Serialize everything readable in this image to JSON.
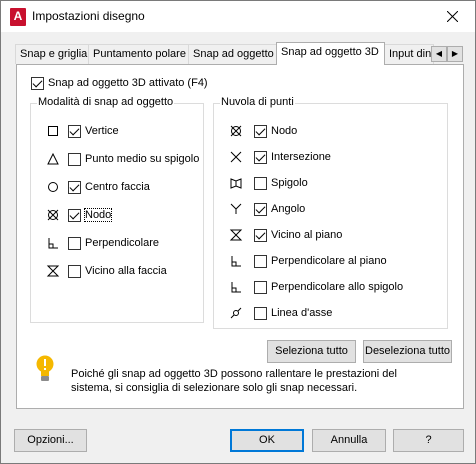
{
  "window": {
    "title": "Impostazioni disegno",
    "app_icon_letter": "A"
  },
  "tabs": [
    {
      "label": "Snap e griglia",
      "active": false
    },
    {
      "label": "Puntamento polare",
      "active": false
    },
    {
      "label": "Snap ad oggetto",
      "active": false
    },
    {
      "label": "Snap ad oggetto 3D",
      "active": true
    },
    {
      "label": "Input dina",
      "active": false
    }
  ],
  "master_toggle": {
    "label": "Snap ad oggetto 3D attivato (F4)",
    "checked": true
  },
  "object_snap_group": {
    "label": "Modalità di snap ad oggetto",
    "items": [
      {
        "label": "Vertice",
        "checked": true,
        "icon": "square-icon"
      },
      {
        "label": "Punto medio su spigolo",
        "checked": false,
        "icon": "triangle-icon"
      },
      {
        "label": "Centro faccia",
        "checked": true,
        "icon": "circle-icon"
      },
      {
        "label": "Nodo",
        "checked": true,
        "icon": "node-icon"
      },
      {
        "label": "Perpendicolare",
        "checked": false,
        "icon": "perpendicular-icon"
      },
      {
        "label": "Vicino alla faccia",
        "checked": false,
        "icon": "hourglass-icon"
      }
    ]
  },
  "point_cloud_group": {
    "label": "Nuvola di punti",
    "items": [
      {
        "label": "Nodo",
        "checked": true,
        "icon": "node-icon"
      },
      {
        "label": "Intersezione",
        "checked": true,
        "icon": "x-icon"
      },
      {
        "label": "Spigolo",
        "checked": false,
        "icon": "edge-icon"
      },
      {
        "label": "Angolo",
        "checked": true,
        "icon": "y-icon"
      },
      {
        "label": "Vicino al piano",
        "checked": true,
        "icon": "hourglass-icon"
      },
      {
        "label": "Perpendicolare al piano",
        "checked": false,
        "icon": "perpendicular-icon"
      },
      {
        "label": "Perpendicolare allo spigolo",
        "checked": false,
        "icon": "perpendicular-icon"
      },
      {
        "label": "Linea d'asse",
        "checked": false,
        "icon": "centerline-icon"
      }
    ]
  },
  "buttons": {
    "select_all": "Seleziona tutto",
    "deselect_all": "Deseleziona tutto",
    "options": "Opzioni...",
    "ok": "OK",
    "cancel": "Annulla",
    "help": "?"
  },
  "info": {
    "text": "Poiché gli snap ad oggetto 3D possono rallentare le prestazioni del sistema, si consiglia di selezionare solo gli snap necessari.",
    "icon": "lightbulb-icon",
    "icon_color": "#f5b800"
  },
  "colors": {
    "accent": "#0078d7",
    "app_icon": "#c8102e"
  }
}
